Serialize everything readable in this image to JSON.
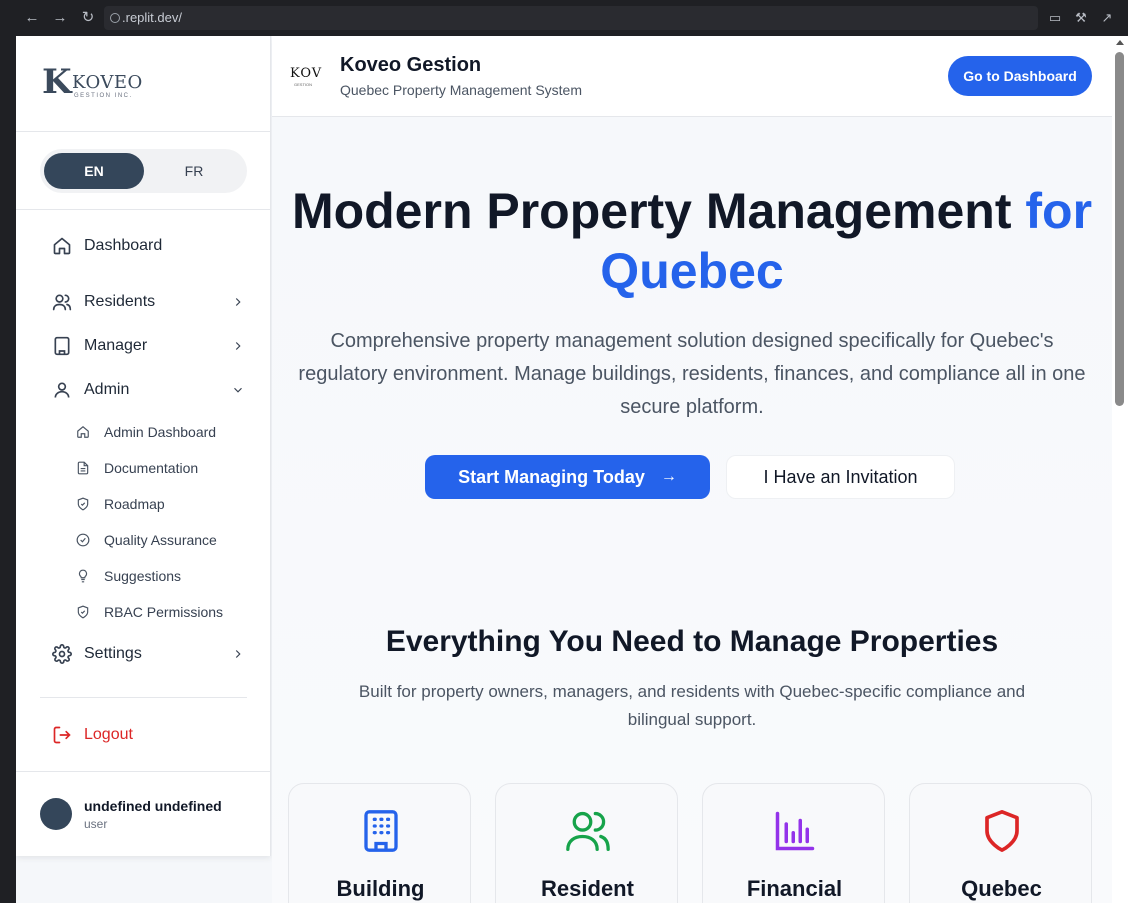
{
  "browser": {
    "url": ".replit.dev/"
  },
  "sidebar": {
    "logo": {
      "letter": "K",
      "word": "KOVEO",
      "sub": "GESTION INC."
    },
    "lang": {
      "en": "EN",
      "fr": "FR",
      "selected": "EN"
    },
    "items": [
      {
        "label": "Dashboard",
        "icon": "home-icon"
      },
      {
        "label": "Residents",
        "icon": "users-icon"
      },
      {
        "label": "Manager",
        "icon": "building-icon"
      },
      {
        "label": "Admin",
        "icon": "user-icon"
      }
    ],
    "admin_sub": [
      {
        "label": "Admin Dashboard",
        "icon": "home-icon"
      },
      {
        "label": "Documentation",
        "icon": "document-icon"
      },
      {
        "label": "Roadmap",
        "icon": "shield-icon"
      },
      {
        "label": "Quality Assurance",
        "icon": "check-circle-icon"
      },
      {
        "label": "Suggestions",
        "icon": "lightbulb-icon"
      },
      {
        "label": "RBAC Permissions",
        "icon": "shield-icon"
      }
    ],
    "settings": {
      "label": "Settings",
      "icon": "gear-icon"
    },
    "logout": {
      "label": "Logout",
      "icon": "logout-icon"
    },
    "user": {
      "name": "undefined undefined",
      "role": "user"
    }
  },
  "header": {
    "logo_text": "KOV",
    "logo_sub": "GESTION",
    "title": "Koveo Gestion",
    "subtitle": "Quebec Property Management System",
    "cta": "Go to Dashboard"
  },
  "hero": {
    "title_dark": "Modern Property Management ",
    "title_blue_1": "for",
    "title_blue_2": "Quebec",
    "description": "Comprehensive property management solution designed specifically for Quebec's regulatory environment. Manage buildings, residents, finances, and compliance all in one secure platform.",
    "primary_button": "Start Managing Today",
    "secondary_button": "I Have an Invitation"
  },
  "features": {
    "title": "Everything You Need to Manage Properties",
    "description": "Built for property owners, managers, and residents with Quebec-specific compliance and bilingual support.",
    "cards": [
      {
        "title": "Building",
        "icon": "building-icon",
        "color": "#2563eb"
      },
      {
        "title": "Resident",
        "icon": "users-icon",
        "color": "#16a34a"
      },
      {
        "title": "Financial",
        "icon": "bar-chart-icon",
        "color": "#9333ea"
      },
      {
        "title": "Quebec",
        "icon": "shield-icon",
        "color": "#dc2626"
      }
    ]
  },
  "colors": {
    "accent": "#2563eb",
    "sidebar_active": "#34465a",
    "logout": "#dc2626"
  }
}
